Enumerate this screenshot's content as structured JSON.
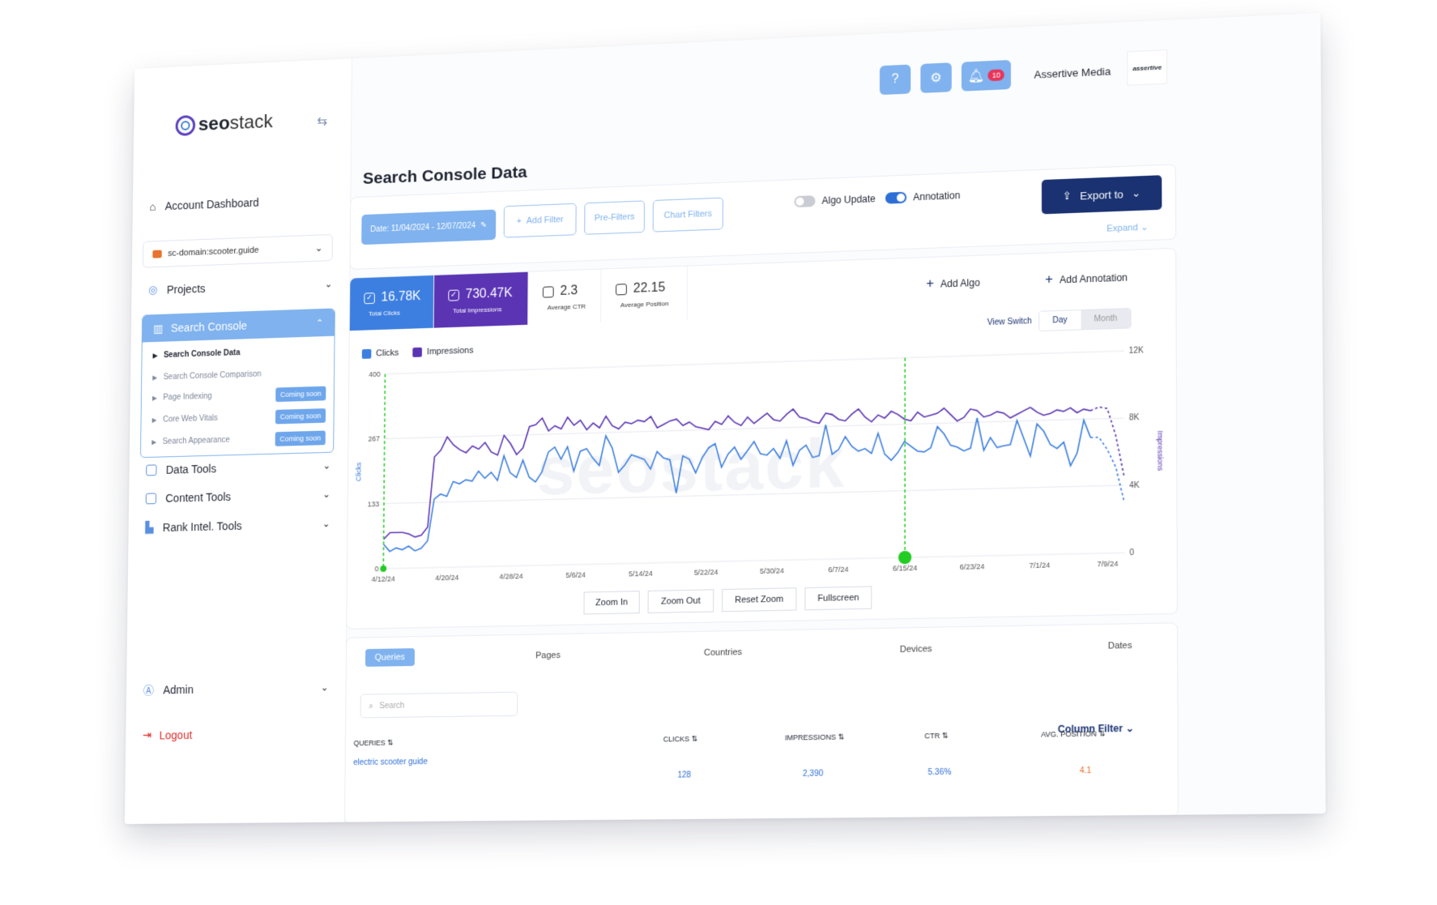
{
  "brand": {
    "logo_bold": "seo",
    "logo_light": "stack"
  },
  "sidebar": {
    "account_dashboard": "Account Dashboard",
    "domain": "sc-domain:scooter.guide",
    "projects": "Projects",
    "search_console": "Search Console",
    "sub_items": [
      {
        "label": "Search Console Data",
        "badge": ""
      },
      {
        "label": "Search Console Comparison",
        "badge": ""
      },
      {
        "label": "Page Indexing",
        "badge": "Coming soon"
      },
      {
        "label": "Core Web Vitals",
        "badge": "Coming soon"
      },
      {
        "label": "Search Appearance",
        "badge": "Coming soon"
      }
    ],
    "data_tools": "Data Tools",
    "content_tools": "Content Tools",
    "rank_intel_tools": "Rank Intel. Tools",
    "admin": "Admin",
    "logout": "Logout"
  },
  "header": {
    "notifications": "10",
    "user_name": "Assertive Media",
    "user_logo": "assertive"
  },
  "page": {
    "title": "Search Console Data"
  },
  "filters": {
    "date_range": "Date: 11/04/2024 - 12/07/2024",
    "add_filter": "Add Filter",
    "pre_filters": "Pre-Filters",
    "chart_filters": "Chart Filters",
    "algo_update": "Algo Update",
    "annotation": "Annotation",
    "export_to": "Export to",
    "expand": "Expand"
  },
  "metrics": [
    {
      "value": "16.78K",
      "label": "Total Clicks"
    },
    {
      "value": "730.47K",
      "label": "Total Impressions"
    },
    {
      "value": "2.3",
      "label": "Average CTR"
    },
    {
      "value": "22.15",
      "label": "Average Position"
    }
  ],
  "actions": {
    "add_algo": "Add Algo",
    "add_annotation": "Add Annotation"
  },
  "view_switch": {
    "label": "View Switch",
    "day": "Day",
    "month": "Month"
  },
  "zoom": {
    "zoom_in": "Zoom In",
    "zoom_out": "Zoom Out",
    "reset_zoom": "Reset Zoom",
    "fullscreen": "Fullscreen"
  },
  "colors": {
    "clicks": "#3d7fe0",
    "impressions": "#5b34b4",
    "accent": "#7fb2ee",
    "navy": "#1a3272"
  },
  "chart_data": {
    "type": "line",
    "xlabel": "",
    "ylabel": "Clicks",
    "y2label": "Impressions",
    "x_ticks": [
      "4/12/24",
      "4/20/24",
      "4/28/24",
      "5/6/24",
      "5/14/24",
      "5/22/24",
      "5/30/24",
      "6/7/24",
      "6/15/24",
      "6/23/24",
      "7/1/24",
      "7/9/24"
    ],
    "y_ticks": [
      "0",
      "133",
      "267",
      "400"
    ],
    "y2_ticks": [
      "0",
      "4K",
      "8K",
      "12K"
    ],
    "ylim": [
      0,
      400
    ],
    "y2lim": [
      0,
      12000
    ],
    "grid": true,
    "series": [
      {
        "name": "Clicks",
        "axis": "left",
        "values": [
          50,
          35,
          42,
          38,
          45,
          35,
          40,
          55,
          140,
          150,
          145,
          175,
          170,
          178,
          175,
          195,
          180,
          192,
          175,
          225,
          190,
          180,
          215,
          180,
          170,
          190,
          230,
          240,
          215,
          240,
          190,
          230,
          235,
          215,
          200,
          260,
          235,
          185,
          200,
          220,
          215,
          210,
          190,
          225,
          212,
          208,
          140,
          215,
          208,
          180,
          210,
          230,
          238,
          190,
          216,
          230,
          205,
          222,
          240,
          215,
          212,
          225,
          205,
          240,
          190,
          220,
          230,
          205,
          208,
          270,
          210,
          220,
          245,
          225,
          215,
          220,
          210,
          250,
          208,
          195,
          210,
          232,
          222,
          212,
          210,
          218,
          260,
          245,
          222,
          218,
          210,
          215,
          275,
          210,
          235,
          215,
          218,
          220,
          268,
          232,
          196,
          260,
          245,
          218,
          210,
          222,
          175,
          200,
          265,
          230
        ],
        "dashed_tail": [
          230,
          205,
          170,
          100
        ]
      },
      {
        "name": "Impressions",
        "axis": "right",
        "values": [
          1800,
          2200,
          2200,
          2200,
          2100,
          1900,
          2000,
          2500,
          6800,
          7200,
          8000,
          7500,
          7200,
          7000,
          7400,
          7200,
          7600,
          7000,
          6800,
          8000,
          7500,
          6800,
          7200,
          8500,
          8600,
          9000,
          8200,
          8500,
          8300,
          9000,
          8500,
          8800,
          8200,
          8600,
          8300,
          9000,
          8400,
          8200,
          8600,
          8500,
          8700,
          8600,
          8900,
          8200,
          8400,
          8600,
          8700,
          8300,
          8500,
          8200,
          8100,
          8000,
          8500,
          8300,
          8800,
          8400,
          8200,
          8700,
          8300,
          8600,
          8900,
          8500,
          8400,
          8800,
          9100,
          8600,
          8500,
          8300,
          8200,
          8800,
          8700,
          8400,
          8300,
          8700,
          9000,
          8500,
          8200,
          8600,
          8400,
          8800,
          8600,
          8300,
          8200,
          8700,
          8400,
          8500,
          8600,
          8900,
          8500,
          8100,
          8300,
          8800,
          8700,
          8300,
          8400,
          8600,
          8500,
          8200,
          8400,
          8600,
          8800,
          8500,
          8300,
          8400,
          8600,
          8500,
          8700,
          8400,
          8600,
          8500
        ],
        "dashed_tail": [
          8700,
          8600,
          7000,
          4500
        ]
      }
    ],
    "markers": [
      "4/12/24",
      "6/15/24"
    ]
  },
  "table": {
    "tabs": [
      "Queries",
      "Pages",
      "Countries",
      "Devices",
      "Dates"
    ],
    "search_placeholder": "Search",
    "column_filter": "Column Filter",
    "headers": [
      "QUERIES",
      "CLICKS",
      "IMPRESSIONS",
      "CTR",
      "AVG. POSITION"
    ],
    "rows": [
      {
        "query": "electric scooter guide",
        "clicks": "128",
        "impressions": "2,390",
        "ctr": "5.36%",
        "position": "4.1"
      }
    ]
  }
}
